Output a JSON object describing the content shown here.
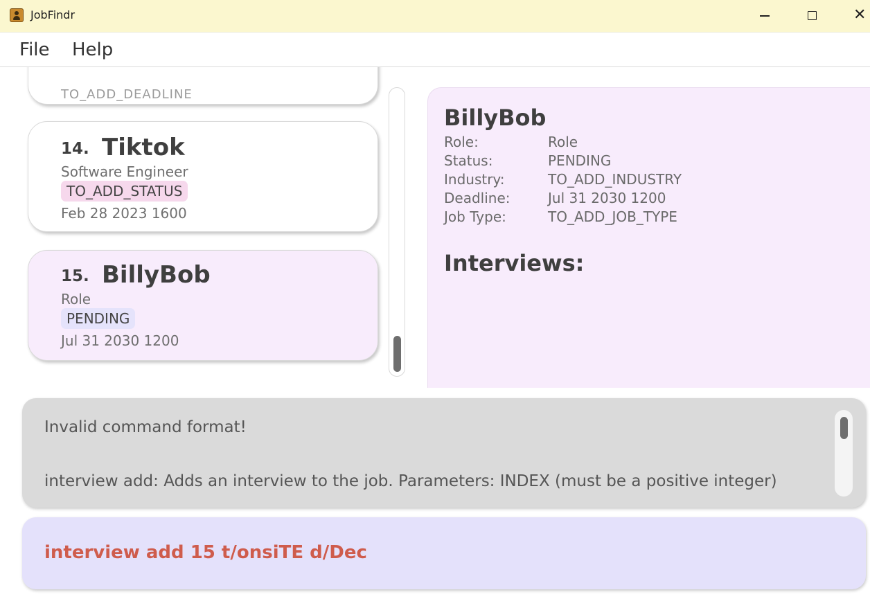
{
  "window": {
    "title": "JobFindr",
    "controls": {
      "minimize": "—",
      "maximize": "☐",
      "close": "✕"
    }
  },
  "menu": {
    "file": "File",
    "help": "Help"
  },
  "job_list": {
    "partial_card_text": "TO_ADD_DEADLINE",
    "cards": [
      {
        "index": "14.",
        "name": "Tiktok",
        "role": "Software Engineer",
        "status": "TO_ADD_STATUS",
        "deadline": "Feb 28 2023 1600"
      },
      {
        "index": "15.",
        "name": "BillyBob",
        "role": "Role",
        "status": "PENDING",
        "deadline": "Jul 31 2030 1200"
      }
    ]
  },
  "detail": {
    "name": "BillyBob",
    "rows": [
      {
        "label": "Role:",
        "value": "Role"
      },
      {
        "label": "Status:",
        "value": "PENDING"
      },
      {
        "label": "Industry:",
        "value": "TO_ADD_INDUSTRY"
      },
      {
        "label": "Deadline:",
        "value": "Jul 31 2030 1200"
      },
      {
        "label": "Job Type:",
        "value": "TO_ADD_JOB_TYPE"
      }
    ],
    "interviews_heading": "Interviews:"
  },
  "result": {
    "line1": "Invalid command format!",
    "line2": "interview add: Adds an interview to the job. Parameters: INDEX (must be a positive integer)"
  },
  "command": {
    "text": "interview add 15 t/onsiTE d/Dec",
    "text_color": "#cf5c4c"
  }
}
